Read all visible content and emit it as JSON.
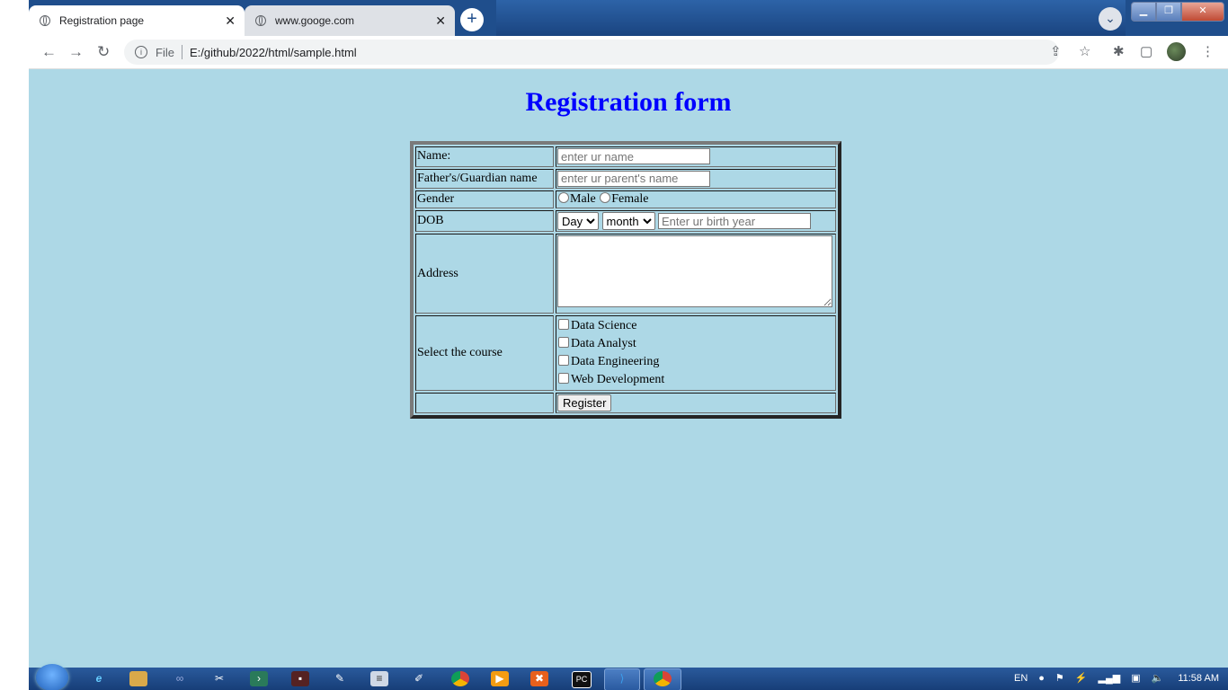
{
  "browser": {
    "tabs": [
      {
        "title": "Registration page",
        "active": true
      },
      {
        "title": "www.googe.com",
        "active": false
      }
    ],
    "address": {
      "scheme_label": "File",
      "url": "E:/github/2022/html/sample.html"
    }
  },
  "page": {
    "heading": "Registration form",
    "form": {
      "name_label": "Name:",
      "name_placeholder": "enter ur name",
      "parent_label": "Father's/Guardian name",
      "parent_placeholder": "enter ur parent's name",
      "gender_label": "Gender",
      "gender_options": [
        "Male",
        "Female"
      ],
      "dob_label": "DOB",
      "dob_day": "Day",
      "dob_month": "month",
      "dob_year_placeholder": "Enter ur birth year",
      "address_label": "Address",
      "course_label": "Select the course",
      "courses": [
        "Data Science",
        "Data Analyst",
        "Data Engineering",
        "Web Development"
      ],
      "submit_label": "Register"
    }
  },
  "taskbar": {
    "language": "EN",
    "time": "11:58 AM"
  },
  "colors": {
    "page_bg": "#add8e6",
    "heading": "#0000ff"
  }
}
